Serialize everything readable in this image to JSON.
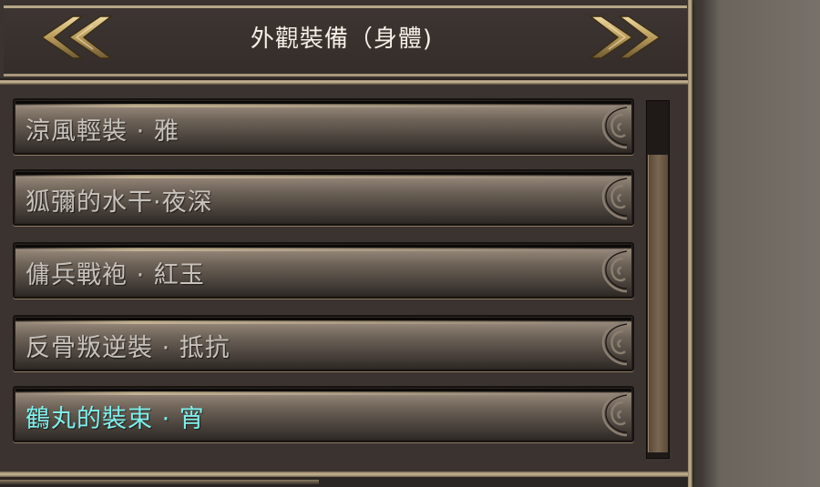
{
  "header": {
    "title": "外觀裝備（身體)",
    "prev_icon": "double-chevron-left-icon",
    "next_icon": "double-chevron-right-icon"
  },
  "items": [
    {
      "label": "涼風輕裝 · 雅",
      "selected": false
    },
    {
      "label": "狐彌的水干·夜深",
      "selected": false
    },
    {
      "label": "傭兵戰袍 · 紅玉",
      "selected": false
    },
    {
      "label": "反骨叛逆裝 · 抵抗",
      "selected": false
    },
    {
      "label": "鶴丸的裝束 · 宵",
      "selected": true
    }
  ],
  "scroll": {
    "position_fraction": 0.15,
    "visible_fraction": 0.85
  },
  "colors": {
    "selected_text": "#7ff0ec",
    "normal_text": "#c7c2bb",
    "title_text": "#f4efe6",
    "gold": "#c9b07a"
  }
}
